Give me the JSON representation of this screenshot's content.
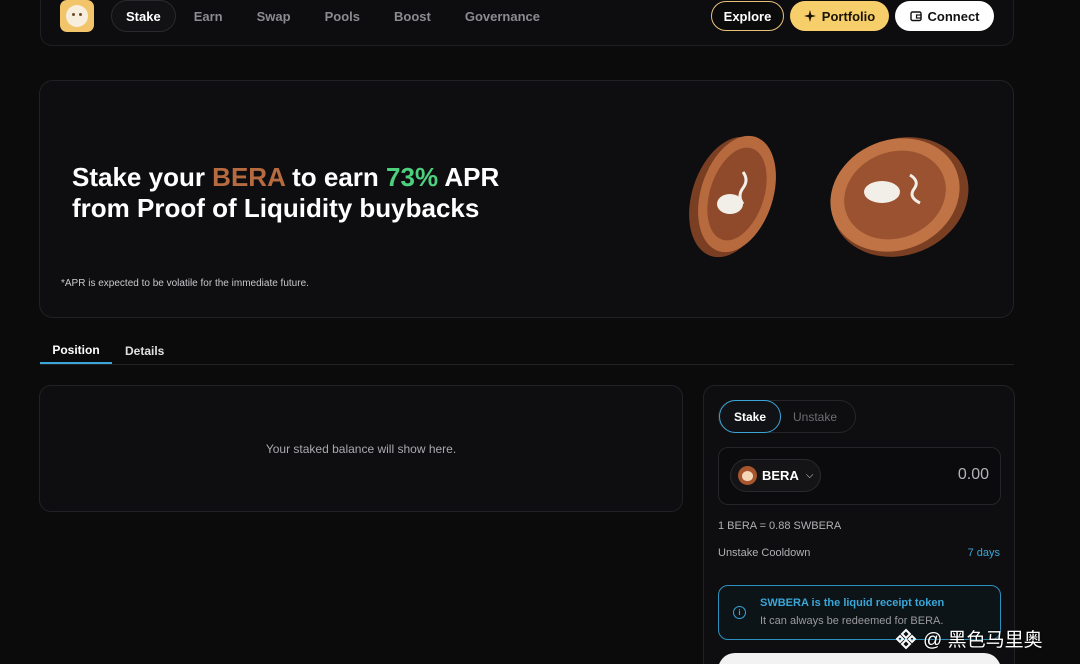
{
  "nav": {
    "items": [
      {
        "label": "Stake",
        "active": true
      },
      {
        "label": "Earn",
        "active": false
      },
      {
        "label": "Swap",
        "active": false
      },
      {
        "label": "Pools",
        "active": false
      },
      {
        "label": "Boost",
        "active": false
      },
      {
        "label": "Governance",
        "active": false
      }
    ],
    "explore_label": "Explore",
    "portfolio_label": "Portfolio",
    "connect_label": "Connect"
  },
  "hero": {
    "title_part1": "Stake your ",
    "title_token": "BERA",
    "title_part2": " to earn ",
    "title_apr": "73%",
    "title_part3": " APR",
    "title_line2": "from Proof of Liquidity buybacks",
    "note": "*APR is expected to be volatile for the immediate future."
  },
  "tabs": {
    "position": "Position",
    "details": "Details"
  },
  "position": {
    "empty_text": "Your staked balance will show here."
  },
  "stake": {
    "mode_stake": "Stake",
    "mode_unstake": "Unstake",
    "token": "BERA",
    "amount": "0.00",
    "rate": "1 BERA = 0.88 SWBERA",
    "cooldown_label": "Unstake Cooldown",
    "cooldown_value": "7 days",
    "info_title": "SWBERA is the liquid receipt token",
    "info_body": "It can always be redeemed for BERA."
  },
  "watermark": "@ 黑色马里奥",
  "colors": {
    "accent_blue": "#3aa6d8",
    "bera_brown": "#b56a3f",
    "apr_green": "#4cd07d",
    "portfolio_yellow": "#f7cf6a"
  }
}
